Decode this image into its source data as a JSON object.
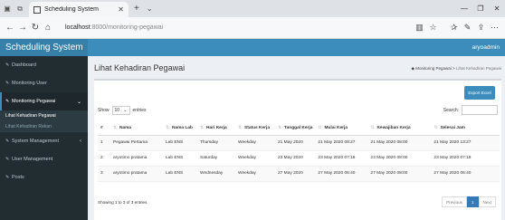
{
  "browser": {
    "tab_title": "Scheduling System",
    "url_host": "localhost",
    "url_path": ":8000/monitoring-pegawai"
  },
  "app": {
    "brand": "Scheduling System",
    "user": "aryoadmin"
  },
  "sidebar": {
    "items": [
      {
        "label": "Dashboard"
      },
      {
        "label": "Monitoring User"
      },
      {
        "label": "Monitoring Pegawai"
      },
      {
        "label": "System Management"
      },
      {
        "label": "User Management"
      },
      {
        "label": "Posts"
      }
    ],
    "sub_items": [
      {
        "label": "Lihat Kehadiran Pegawai"
      },
      {
        "label": "Lihat Kehadiran Rekan"
      }
    ]
  },
  "page": {
    "title": "Lihat Kehadiran Pegawai",
    "breadcrumb_root": "Monitoring Pegawai",
    "breadcrumb_sep": ">",
    "breadcrumb_current": "Lihat Kehadiran Pegawai"
  },
  "toolbar": {
    "export_label": "Export Excel",
    "show_label": "Show",
    "entries_value": "10",
    "entries_label": "entries",
    "search_label": "Search:"
  },
  "table": {
    "headers": [
      "#",
      "Nama",
      "Nama Lab",
      "Hari Kerja",
      "Status Kerja",
      "Tanggal Kerja",
      "Mulai Kerja",
      "Kewajiban Kerja",
      "Selesai Jam"
    ],
    "rows": [
      [
        "1",
        "Pegawai Pertama",
        "Lab ENS",
        "Thursday",
        "Weekday",
        "21 May 2020",
        "21 May 2020 08:27",
        "21 May 2020 08:00",
        "21 May 2020 13:27"
      ],
      [
        "2",
        "aryotimo pratama",
        "Lab ENS",
        "Saturday",
        "Weekday",
        "23 May 2020",
        "23 May 2020 07:16",
        "23 May 2020 08:00",
        "23 May 2020 07:18"
      ],
      [
        "3",
        "aryotimo pratama",
        "Lab ENS",
        "Wednesday",
        "Weekday",
        "27 May 2020",
        "27 May 2020 06:40",
        "27 May 2020 08:00",
        "27 May 2020 06:40"
      ]
    ]
  },
  "footer": {
    "info": "Showing 1 to 3 of 3 entries",
    "previous": "Previous",
    "current_page": "1",
    "next": "Next"
  }
}
